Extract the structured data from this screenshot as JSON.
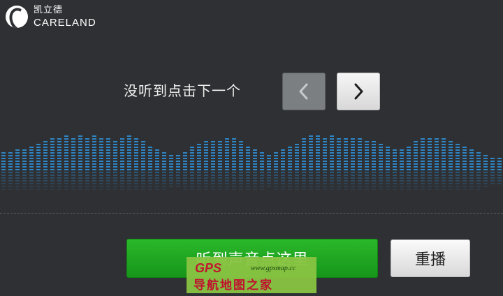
{
  "logo": {
    "cn": "凯立德",
    "en": "CARELAND",
    "icon": "careland-logo-icon"
  },
  "prompt": {
    "text": "没听到点击下一个"
  },
  "nav": {
    "prev_icon": "chevron-left-icon",
    "next_icon": "chevron-right-icon"
  },
  "equalizer": {
    "color": "#2f86c6",
    "levels": [
      7,
      7,
      8,
      8,
      9,
      10,
      11,
      12,
      12,
      13,
      12,
      13,
      12,
      13,
      12,
      12,
      11,
      12,
      13,
      12,
      11,
      9,
      8,
      7,
      6,
      6,
      7,
      9,
      10,
      11,
      11,
      11,
      12,
      12,
      11,
      9,
      8,
      7,
      6,
      7,
      8,
      9,
      10,
      12,
      13,
      13,
      12,
      13,
      12,
      12,
      12,
      12,
      11,
      11,
      10,
      9,
      8,
      8,
      9,
      11,
      12,
      12,
      12,
      12,
      11,
      10,
      9,
      8,
      7,
      6,
      5,
      5
    ]
  },
  "buttons": {
    "hear": "听到声音点这里",
    "replay": "重播"
  },
  "watermark": {
    "gps": "GPS",
    "url": "www.gpsmap.cc",
    "title": "导航地图之家"
  },
  "colors": {
    "background": "#2e3033",
    "accent_green": "#1fa51f",
    "eq_blue": "#2f86c6"
  }
}
